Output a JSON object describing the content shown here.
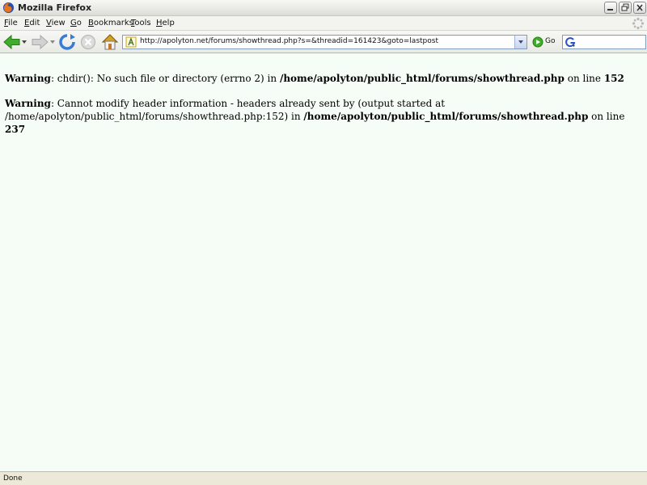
{
  "window": {
    "title": "Mozilla Firefox"
  },
  "menu": {
    "file": {
      "acc": "F",
      "rest": "ile"
    },
    "edit": {
      "acc": "E",
      "rest": "dit"
    },
    "view": {
      "acc": "V",
      "rest": "iew"
    },
    "go": {
      "acc": "G",
      "rest": "o"
    },
    "bookmarks": {
      "acc": "B",
      "rest": "ookmarks"
    },
    "tools": {
      "acc": "T",
      "rest": "ools"
    },
    "help": {
      "acc": "H",
      "rest": "elp"
    }
  },
  "toolbar": {
    "url": "http://apolyton.net/forums/showthread.php?s=&threadid=161423&goto=lastpost",
    "go_label": "Go",
    "search_value": ""
  },
  "content": {
    "warning1": {
      "label": "Warning",
      "text1": ": chdir(): No such file or directory (errno 2) in ",
      "path": "/home/apolyton/public_html/forums/showthread.php",
      "text2": " on line ",
      "line": "152"
    },
    "warning2": {
      "label": "Warning",
      "text1": ": Cannot modify header information - headers already sent by (output started at /home/apolyton/public_html/forums/showthread.php:152) in ",
      "path": "/home/apolyton/public_html/forums/showthread.php",
      "text2": " on line ",
      "line": "237"
    }
  },
  "status": {
    "text": "Done"
  },
  "colors": {
    "content_bg": "#f6fcf6",
    "chrome_bg": "#ece9d8",
    "back_arrow": "#3fae2a",
    "reload": "#3a7bd5"
  }
}
